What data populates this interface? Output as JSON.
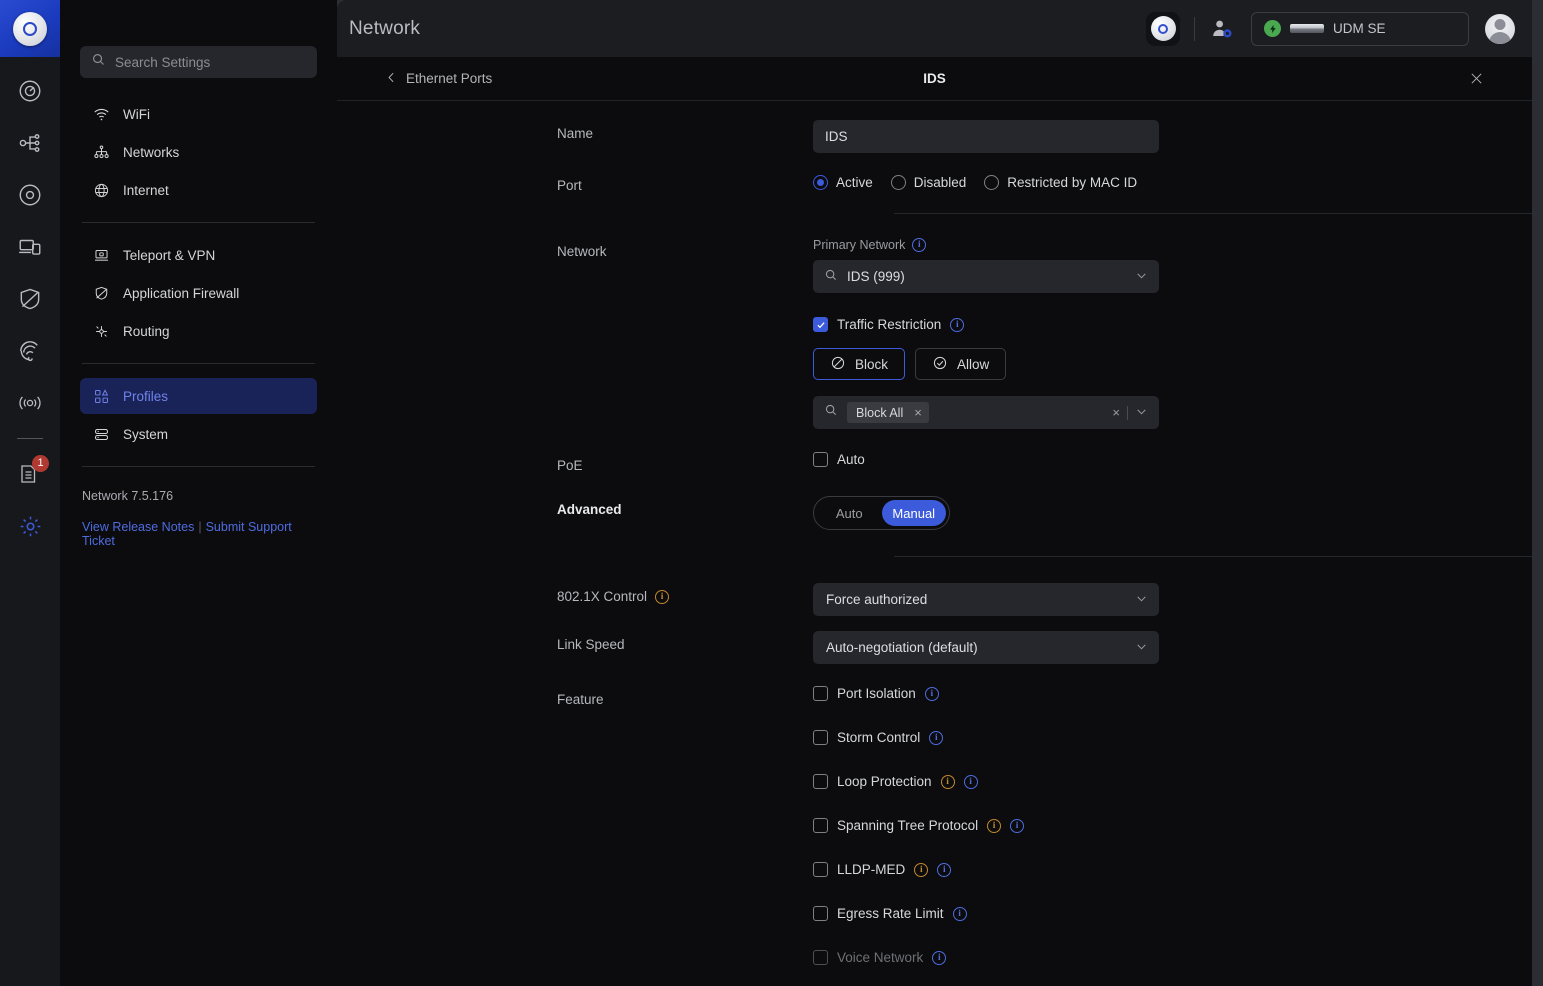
{
  "rail": {
    "logo_icon": "unifi-logo-icon",
    "items": [
      {
        "name": "dashboard",
        "icon": "dashboard-icon"
      },
      {
        "name": "topology",
        "icon": "topology-icon"
      },
      {
        "name": "devices",
        "icon": "devices-circle-icon"
      },
      {
        "name": "clients",
        "icon": "client-devices-icon"
      },
      {
        "name": "security",
        "icon": "shield-icon"
      },
      {
        "name": "wifiman",
        "icon": "wifiman-icon"
      },
      {
        "name": "broadcast",
        "icon": "broadcast-icon"
      }
    ],
    "insights": {
      "name": "insights",
      "icon": "list-document-icon",
      "badge": "1"
    },
    "settings": {
      "name": "settings",
      "icon": "gear-icon"
    }
  },
  "nav": {
    "search_placeholder": "Search Settings",
    "search_icon": "search-icon",
    "groups": [
      [
        {
          "label": "WiFi",
          "icon": "wifi-icon",
          "active": false
        },
        {
          "label": "Networks",
          "icon": "networks-icon",
          "active": false
        },
        {
          "label": "Internet",
          "icon": "globe-icon",
          "active": false
        }
      ],
      [
        {
          "label": "Teleport & VPN",
          "icon": "teleport-vpn-icon",
          "active": false
        },
        {
          "label": "Application Firewall",
          "icon": "shield-icon",
          "active": false
        },
        {
          "label": "Routing",
          "icon": "routing-icon",
          "active": false
        }
      ],
      [
        {
          "label": "Profiles",
          "icon": "profiles-icon",
          "active": true
        },
        {
          "label": "System",
          "icon": "system-icon",
          "active": false
        }
      ]
    ],
    "version": "Network 7.5.176",
    "release_notes_label": "View Release Notes",
    "separator": "|",
    "support_ticket_label": "Submit Support Ticket"
  },
  "topbar": {
    "app_title": "Network",
    "console_logo_icon": "unifi-console-icon",
    "people_icon": "user-admin-icon",
    "device": {
      "status_icon": "bolt-icon",
      "thumbnail_icon": "udm-device-icon",
      "name": "UDM SE"
    },
    "avatar_icon": "avatar-icon"
  },
  "panel": {
    "back_label": "Ethernet Ports",
    "back_icon": "chevron-left-icon",
    "title": "IDS",
    "close_icon": "close-icon"
  },
  "form": {
    "name": {
      "label": "Name",
      "value": "IDS"
    },
    "port": {
      "label": "Port",
      "options": [
        {
          "label": "Active",
          "selected": true
        },
        {
          "label": "Disabled",
          "selected": false
        },
        {
          "label": "Restricted by MAC ID",
          "selected": false
        }
      ]
    },
    "network": {
      "label": "Network",
      "primary_label": "Primary Network",
      "primary_info_icon": "info-icon",
      "primary_value": "IDS (999)",
      "primary_search_icon": "search-icon",
      "primary_chevron_icon": "chevron-down-icon",
      "traffic_restriction": {
        "label": "Traffic Restriction",
        "checked": true,
        "info_icon": "info-icon"
      },
      "mode_buttons": [
        {
          "label": "Block",
          "icon": "block-icon",
          "selected": true
        },
        {
          "label": "Allow",
          "icon": "check-circle-icon",
          "selected": false
        }
      ],
      "restriction_field": {
        "search_icon": "search-icon",
        "chips": [
          {
            "label": "Block All",
            "remove_icon": "close-icon"
          }
        ],
        "clear_icon": "close-icon",
        "chevron_icon": "chevron-down-icon"
      }
    },
    "poe": {
      "label": "PoE",
      "option_label": "Auto",
      "checked": false
    },
    "advanced": {
      "label": "Advanced",
      "options": [
        {
          "label": "Auto",
          "selected": false
        },
        {
          "label": "Manual",
          "selected": true
        }
      ]
    },
    "dot1x": {
      "label": "802.1X Control",
      "info_icon": "info-icon",
      "info_tone": "amber",
      "value": "Force authorized",
      "chevron_icon": "chevron-down-icon"
    },
    "link_speed": {
      "label": "Link Speed",
      "value": "Auto-negotiation (default)",
      "chevron_icon": "chevron-down-icon"
    },
    "feature": {
      "label": "Feature",
      "items": [
        {
          "label": "Port Isolation",
          "checked": false,
          "disabled": false,
          "warn_info": false,
          "info_icon": "info-icon"
        },
        {
          "label": "Storm Control",
          "checked": false,
          "disabled": false,
          "warn_info": false,
          "info_icon": "info-icon"
        },
        {
          "label": "Loop Protection",
          "checked": false,
          "disabled": false,
          "warn_info": true,
          "info_icon": "info-icon"
        },
        {
          "label": "Spanning Tree Protocol",
          "checked": false,
          "disabled": false,
          "warn_info": true,
          "info_icon": "info-icon"
        },
        {
          "label": "LLDP-MED",
          "checked": false,
          "disabled": false,
          "warn_info": true,
          "info_icon": "info-icon"
        },
        {
          "label": "Egress Rate Limit",
          "checked": false,
          "disabled": false,
          "warn_info": false,
          "info_icon": "info-icon"
        },
        {
          "label": "Voice Network",
          "checked": false,
          "disabled": true,
          "warn_info": false,
          "info_icon": "info-icon"
        }
      ]
    }
  },
  "colors": {
    "accent": "#3b5bdb",
    "link": "#4e6ce0",
    "warn": "#c2882e",
    "status_ok": "#4aa851",
    "badge": "#b03a32",
    "panel_bg": "#0c0c0e",
    "chrome_bg": "#1c1d21"
  }
}
